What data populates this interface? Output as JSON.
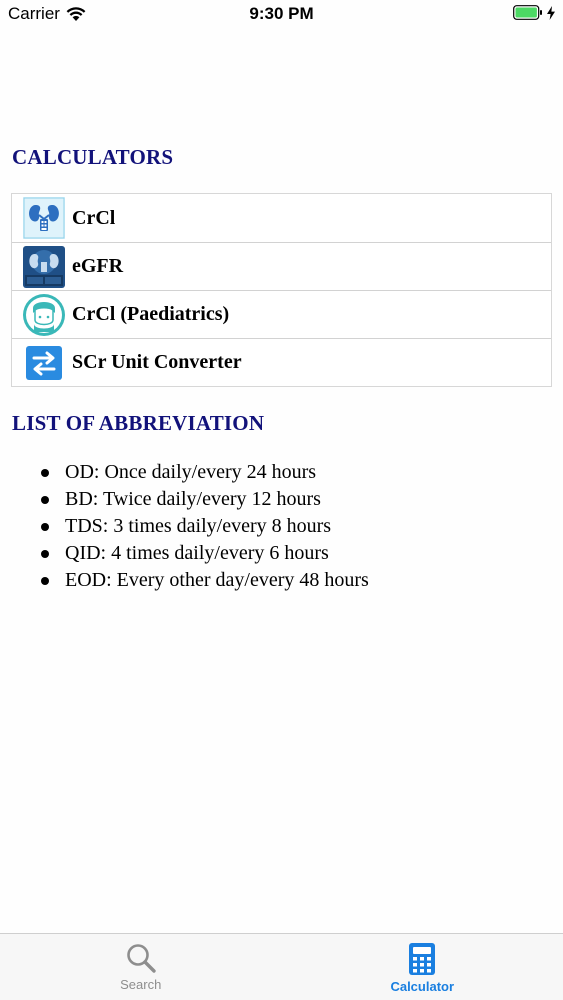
{
  "status_bar": {
    "carrier": "Carrier",
    "time": "9:30 PM",
    "icons": [
      "wifi-icon",
      "battery-icon",
      "charging-bolt-icon"
    ],
    "battery_color": "#4cd964"
  },
  "calculators": {
    "heading": "CALCULATORS",
    "heading_color": "#12127a",
    "items": [
      {
        "label": "CrCl",
        "icon": "kidney-icon"
      },
      {
        "label": "eGFR",
        "icon": "egfr-calc-icon"
      },
      {
        "label": "CrCl (Paediatrics)",
        "icon": "child-icon"
      },
      {
        "label": "SCr Unit Converter",
        "icon": "swap-arrows-icon"
      }
    ]
  },
  "abbreviations": {
    "heading": "LIST OF ABBREVIATION",
    "items": [
      "OD: Once daily/every 24 hours",
      "BD: Twice daily/every 12 hours",
      "TDS: 3 times daily/every 8 hours",
      "QID: 4 times daily/every 6 hours",
      "EOD: Every other day/every 48 hours"
    ]
  },
  "tab_bar": {
    "tabs": [
      {
        "label": "Search",
        "icon": "search-icon",
        "active": false
      },
      {
        "label": "Calculator",
        "icon": "calculator-icon",
        "active": true
      }
    ],
    "active_color": "#1a7fe0",
    "inactive_color": "#8e8e8e"
  }
}
